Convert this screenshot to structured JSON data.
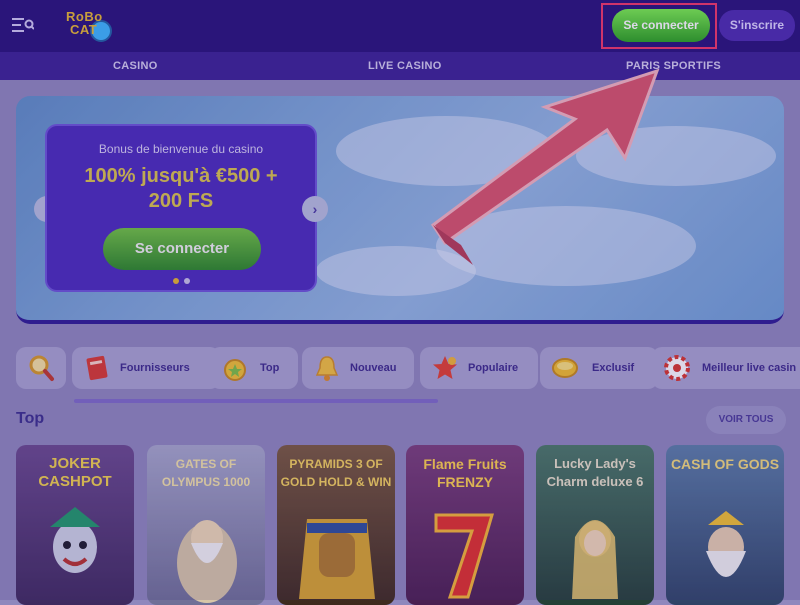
{
  "header": {
    "logo_line1": "RoBo",
    "logo_line2": "CAT",
    "login_label": "Se connecter",
    "signup_label": "S'inscrire"
  },
  "nav": {
    "items": [
      "CASINO",
      "LIVE CASINO",
      "PARIS SPORTIFS"
    ]
  },
  "banner": {
    "subtitle": "Bonus de bienvenue du casino",
    "title_line1": "100% jusqu'à €500 +",
    "title_line2": "200 FS",
    "cta_label": "Se connecter"
  },
  "categories": [
    {
      "label": "",
      "icon": "search-icon"
    },
    {
      "label": "Fournisseurs",
      "icon": "providers-icon"
    },
    {
      "label": "Top",
      "icon": "medal-icon"
    },
    {
      "label": "Nouveau",
      "icon": "bell-icon"
    },
    {
      "label": "Populaire",
      "icon": "star-icon"
    },
    {
      "label": "Exclusif",
      "icon": "coin-icon"
    },
    {
      "label": "Meilleur live casin",
      "icon": "roulette-icon"
    }
  ],
  "section": {
    "title": "Top",
    "see_all_label": "VOIR TOUS"
  },
  "games": [
    {
      "title": "JOKER CASHPOT",
      "color": "#5b3f7f"
    },
    {
      "title": "GATES OF OLYMPUS 1000",
      "color": "#8d8fb5"
    },
    {
      "title": "PYRAMIDS 3 OF GOLD HOLD & WIN",
      "color": "#6b4f3a"
    },
    {
      "title": "Flame Fruits FRENZY",
      "color": "#6b3a6a"
    },
    {
      "title": "Lucky Lady's Charm deluxe 6",
      "color": "#3e5f50"
    },
    {
      "title": "CASH OF GODS",
      "color": "#4c6a8c"
    }
  ]
}
